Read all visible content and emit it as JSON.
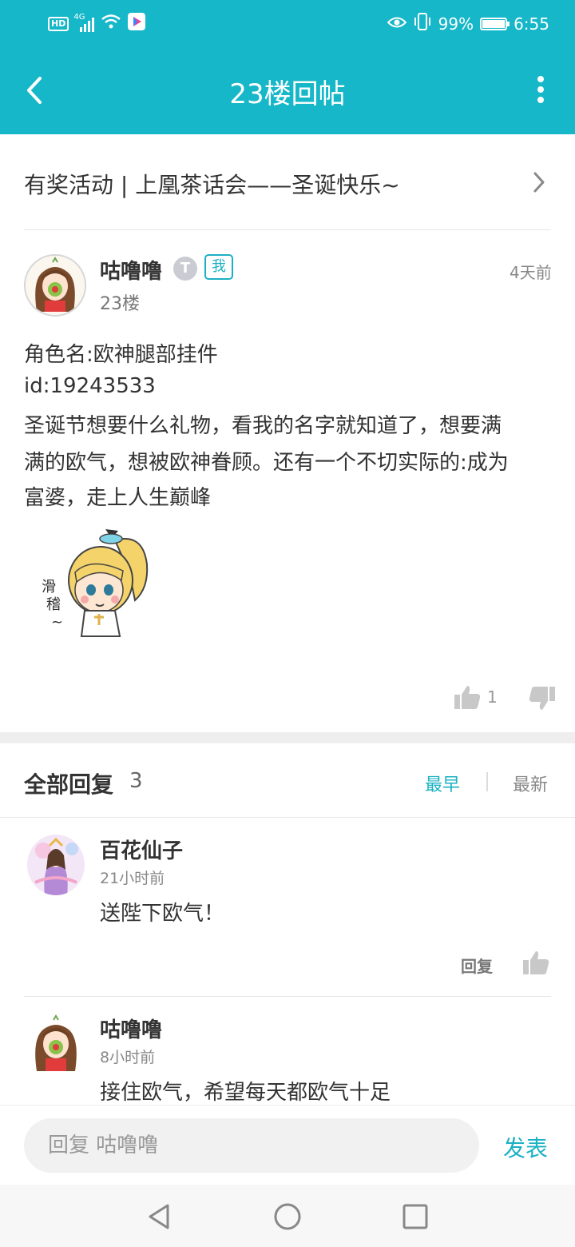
{
  "status_bar": {
    "hd": "HD",
    "network": "4G",
    "battery_percent": "99%",
    "battery_level": 0.99,
    "time": "6:55"
  },
  "app_bar": {
    "title": "23楼回帖",
    "back_icon": "chevron-left-icon",
    "more_icon": "more-vert-icon"
  },
  "topic": {
    "title": "有奖活动 | 上凰茶话会——圣诞快乐~"
  },
  "post": {
    "author": "咕噜噜",
    "title_badge": "T",
    "me_badge": "我",
    "floor": "23楼",
    "time": "4天前",
    "lines": [
      "角色名:欧神腿部挂件",
      "id:19243533",
      "圣诞节想要什么礼物，看我的名字就知道了，想要满",
      "满的欧气，想被欧神眷顾。还有一个不切实际的:成为",
      "富婆，走上人生巅峰"
    ],
    "like_count": "1"
  },
  "replies_header": {
    "title": "全部回复",
    "count": "3",
    "sort_earliest": "最早",
    "sort_newest": "最新"
  },
  "replies": [
    {
      "author": "百花仙子",
      "time": "21小时前",
      "text": "送陛下欧气！",
      "reply_label": "回复"
    },
    {
      "author": "咕噜噜",
      "time": "8小时前",
      "text": "接住欧气，希望每天都欧气十足"
    }
  ],
  "composer": {
    "placeholder": "回复 咕噜噜",
    "send_label": "发表"
  },
  "colors": {
    "accent": "#15b7c8",
    "link": "#1bb1c4"
  }
}
